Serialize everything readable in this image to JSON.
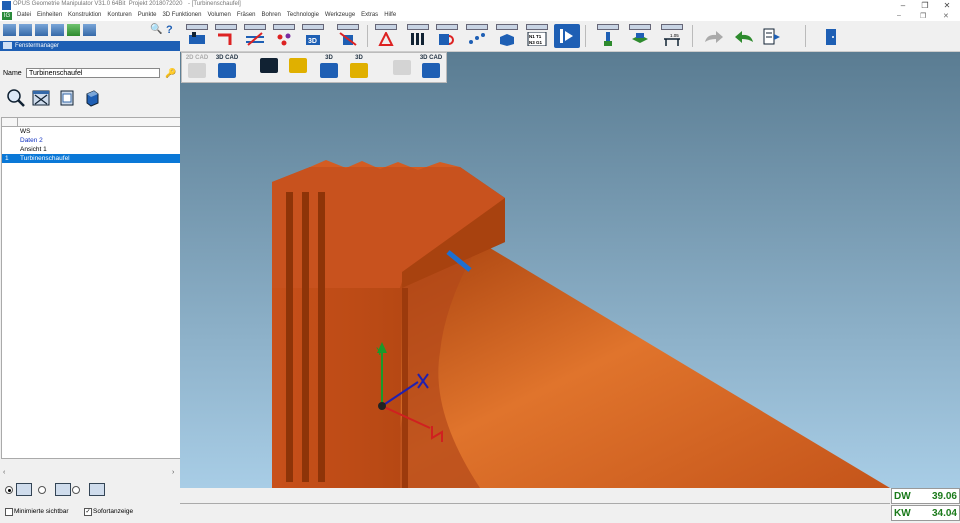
{
  "window": {
    "title": "OPUS Geometrie Manipulator V31.0 64Bit",
    "project": "Projekt 2018072020",
    "document": "- [Turbinenschaufel]"
  },
  "menu": {
    "logo": "IG",
    "items": [
      "Datei",
      "Einheiten",
      "Konstruktion",
      "Konturen",
      "Punkte",
      "3D Funktionen",
      "Volumen",
      "Fräsen",
      "Bohren",
      "Technologie",
      "Werkzeuge",
      "Extras",
      "Hilfe"
    ],
    "help_icon": "?"
  },
  "left_panel": {
    "header": "Fenstermanager",
    "name_label": "Name",
    "name_value": "Turbinenschaufel",
    "tree_rows": [
      {
        "index": "",
        "label": "WS",
        "style": "normal",
        "selected": false
      },
      {
        "index": "",
        "label": "Daten 2",
        "style": "blue",
        "selected": false
      },
      {
        "index": "",
        "label": "Ansicht 1",
        "style": "normal",
        "selected": false
      },
      {
        "index": "1",
        "label": "Turbinenschaufel",
        "style": "normal",
        "selected": true
      }
    ],
    "checkbox_minimized_label": "Minimierte sichtbar",
    "checkbox_instant_label": "Sofortanzeige",
    "checkbox_instant_checked": true,
    "checkbox_minimized_checked": false
  },
  "toolbar2": {
    "cad_labels": [
      "2D CAD",
      "3D CAD",
      "",
      "3D",
      "3D",
      "",
      "3D CAD"
    ],
    "cad_3d": "3D"
  },
  "status": {
    "dw_label": "DW",
    "dw_value": "39.06",
    "kw_label": "KW",
    "kw_value": "34.04"
  },
  "colors": {
    "accent": "#1e5fb4",
    "selection": "#0a78d7",
    "model": "#c8501a",
    "sky_top": "#5a7c92",
    "sky_bottom": "#a8cde6",
    "status_green": "#1a7a1a"
  }
}
